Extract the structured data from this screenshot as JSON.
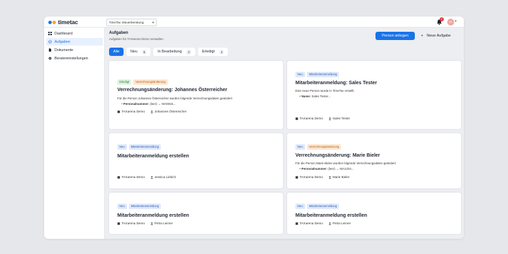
{
  "app": {
    "name": "timetac",
    "logo_colors": [
      "#1a73e8",
      "#f5a623"
    ]
  },
  "topbar": {
    "company_select": "TimeTac Steuerberatung",
    "notification_count": "2",
    "avatar_initials": "AT"
  },
  "sidebar": {
    "items": [
      {
        "label": "Dashboard",
        "icon": "grid-icon"
      },
      {
        "label": "Aufgaben",
        "icon": "check-circle-icon"
      },
      {
        "label": "Dokumente",
        "icon": "document-icon"
      },
      {
        "label": "Beratereinstellungen",
        "icon": "gear-icon"
      }
    ]
  },
  "page": {
    "title": "Aufgaben",
    "subtitle": "Aufgaben für TAXarena Demo verwalten",
    "primary_button": "Person anlegen",
    "secondary_button": "Neue Aufgabe",
    "secondary_icon": "+"
  },
  "tabs": [
    {
      "label": "Alle",
      "count": ""
    },
    {
      "label": "Neu",
      "count": "6"
    },
    {
      "label": "In Bearbeitung",
      "count": "2"
    },
    {
      "label": "Erledigt",
      "count": "4"
    }
  ],
  "cards": [
    {
      "tags": [
        {
          "text": "Erledigt",
          "style": "green"
        },
        {
          "text": "Verrechnungsänderung",
          "style": "orange"
        }
      ],
      "title": "Verrechnungsänderung: Johannes Österreicher",
      "desc": "Für die Person Johannes Österreicher wurden folgende Verrechnungsdaten geändert:",
      "bullet_key": "Personalnummer:",
      "bullet_val": "(leer) → MA0815...",
      "company": "TAXarena Demo",
      "person": "Johannes Österreicher"
    },
    {
      "tags": [
        {
          "text": "Neu",
          "style": "blue"
        },
        {
          "text": "Mitarbeiteranmeldung",
          "style": "blue"
        }
      ],
      "title": "Mitarbeiteranmeldung: Sales Tester",
      "desc": "Eine neue Person wurde in TimeTac erstellt:",
      "bullet_key": "Name:",
      "bullet_val": "Sales Tester...",
      "company": "TAXarena Demo",
      "person": "Sales Tester"
    },
    {
      "tags": [
        {
          "text": "Neu",
          "style": "blue"
        },
        {
          "text": "Mitarbeiteranmeldung",
          "style": "blue"
        }
      ],
      "title": "Mitarbeiteranmeldung erstellen",
      "company": "TAXarena Demo",
      "person": "Jessica Liebich"
    },
    {
      "tags": [
        {
          "text": "Neu",
          "style": "blue"
        },
        {
          "text": "Verrechnungsänderung",
          "style": "orange"
        }
      ],
      "title": "Verrechnungsänderung: Marie Bieler",
      "desc": "Für die Person Marie Bieler wurden folgende Verrechnungsdaten geändert:",
      "bullet_key": "Personalnummer:",
      "bullet_val": "(leer) → MA1234...",
      "company": "TAXarena Demo",
      "person": "Marie Bieler"
    },
    {
      "tags": [
        {
          "text": "Neu",
          "style": "blue"
        },
        {
          "text": "Mitarbeiteranmeldung",
          "style": "blue"
        }
      ],
      "title": "Mitarbeiteranmeldung erstellen",
      "company": "TAXarena Demo",
      "person": "Petra Leimer"
    },
    {
      "tags": [
        {
          "text": "Neu",
          "style": "blue"
        },
        {
          "text": "Mitarbeiteranmeldung",
          "style": "blue"
        }
      ],
      "title": "Mitarbeiteranmeldung erstellen",
      "company": "TAXarena Demo",
      "person": "Petra Leimer"
    }
  ]
}
